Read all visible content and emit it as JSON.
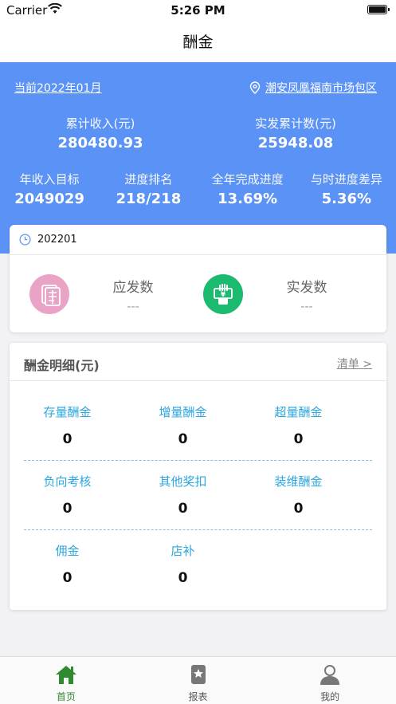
{
  "status_bar": {
    "carrier": "Carrier",
    "time": "5:26 PM"
  },
  "nav": {
    "title": "酬金"
  },
  "header": {
    "period": "当前2022年01月",
    "location": "潮安凤凰福南市场包区",
    "top_stats": [
      {
        "label": "累计收入(元)",
        "value": "280480.93"
      },
      {
        "label": "实发累计数(元)",
        "value": "25948.08"
      }
    ],
    "bottom_stats": [
      {
        "label": "年收入目标",
        "value": "2049029"
      },
      {
        "label": "进度排名",
        "value": "218/218"
      },
      {
        "label": "全年完成进度",
        "value": "13.69%"
      },
      {
        "label": "与时进度差异",
        "value": "5.36%"
      }
    ]
  },
  "payment_card": {
    "period": "202201",
    "items": [
      {
        "label": "应发数",
        "value": "---",
        "icon": "document-icon",
        "color": "#e8a3c6"
      },
      {
        "label": "实发数",
        "value": "---",
        "icon": "cash-hand-icon",
        "color": "#1cba6e"
      }
    ]
  },
  "detail_card": {
    "title": "酬金明细(元)",
    "link": "清单 >",
    "rows": [
      [
        {
          "label": "存量酬金",
          "value": "0"
        },
        {
          "label": "增量酬金",
          "value": "0"
        },
        {
          "label": "超量酬金",
          "value": "0"
        }
      ],
      [
        {
          "label": "负向考核",
          "value": "0"
        },
        {
          "label": "其他奖扣",
          "value": "0"
        },
        {
          "label": "装维酬金",
          "value": "0"
        }
      ],
      [
        {
          "label": "佣金",
          "value": "0"
        },
        {
          "label": "店补",
          "value": "0"
        }
      ]
    ]
  },
  "tabbar": {
    "tabs": [
      {
        "label": "首页",
        "icon": "home-icon",
        "active": true
      },
      {
        "label": "报表",
        "icon": "report-icon",
        "active": false
      },
      {
        "label": "我的",
        "icon": "profile-icon",
        "active": false
      }
    ]
  },
  "colors": {
    "header_bg": "#5b92f5",
    "accent_blue": "#2aa6e0",
    "tab_active": "#2f8a2f"
  }
}
